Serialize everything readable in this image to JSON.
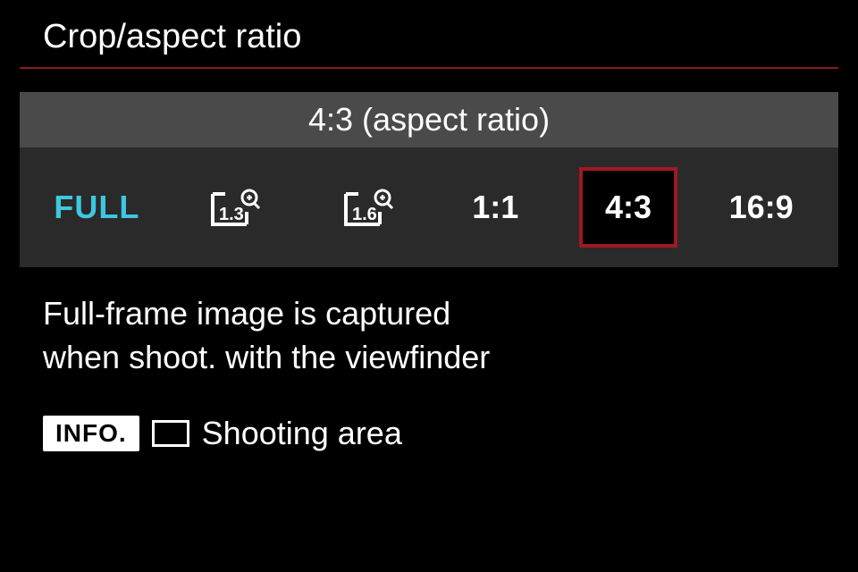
{
  "title": "Crop/aspect ratio",
  "selection_label": "4:3 (aspect ratio)",
  "options": {
    "full": "FULL",
    "crop13": "1.3",
    "crop16": "1.6",
    "ratio11": "1:1",
    "ratio43": "4:3",
    "ratio169": "16:9"
  },
  "description_line1": "Full-frame image is captured",
  "description_line2": "when shoot. with the viewfinder",
  "info_badge": "INFO.",
  "footer_label": "Shooting area",
  "colors": {
    "accent_cyan": "#3cc8e0",
    "divider_red": "#8a1a1a",
    "select_red": "#a01820"
  }
}
